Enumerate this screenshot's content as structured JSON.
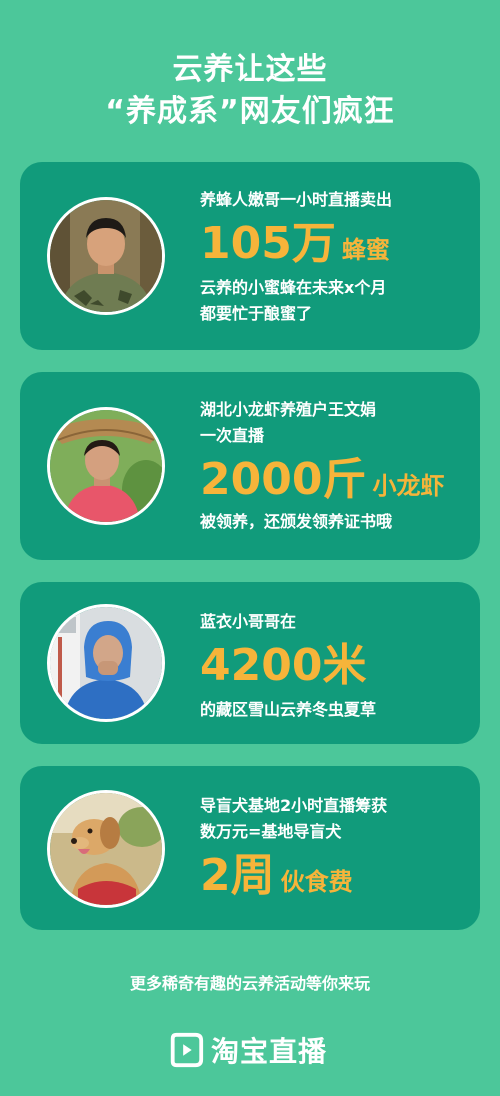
{
  "headline": {
    "line1": "云养让这些",
    "line2": "“养成系”网友们疯狂"
  },
  "cards": [
    {
      "intro": "养蜂人嫩哥一小时直播卖出",
      "big_number": "105万",
      "big_unit": "蜂蜜",
      "desc_line1": "云养的小蜜蜂在未来x个月",
      "desc_line2": "都要忙于酿蜜了"
    },
    {
      "intro_line1": "湖北小龙虾养殖户王文娟",
      "intro_line2": "一次直播",
      "big_number": "2000斤",
      "big_unit": "小龙虾",
      "desc": "被领养，还颁发领养证书哦"
    },
    {
      "intro": "蓝衣小哥哥在",
      "big_number": "4200米",
      "desc": "的藏区雪山云养冬虫夏草"
    },
    {
      "intro_line1": "导盲犬基地2小时直播筹获",
      "intro_line2": "数万元=基地导盲犬",
      "big_number": "2周",
      "big_unit": "伙食费"
    }
  ],
  "footer": {
    "tagline": "更多稀奇有趣的云养活动等你来玩",
    "brand": "淘宝直播"
  },
  "colors": {
    "background": "#4cc79a",
    "card": "#119b7b",
    "accent": "#f6b43a",
    "text": "#ffffff"
  }
}
